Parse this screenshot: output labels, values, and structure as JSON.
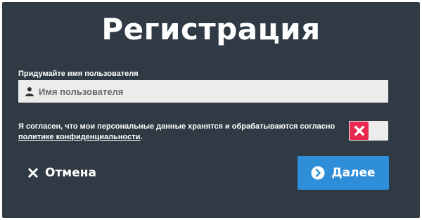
{
  "title": "Регистрация",
  "username": {
    "label": "Придумайте имя пользователя",
    "placeholder": "Имя пользователя",
    "value": ""
  },
  "consent": {
    "text_before": "Я согласен, что мои персональные данные хранятся и обрабатываются согласно ",
    "link_text": "политике конфиденциальности",
    "text_after": ".",
    "checked": false
  },
  "buttons": {
    "cancel_label": "Отмена",
    "next_label": "Далее"
  },
  "icons": {
    "user": "user-icon",
    "toggle_off": "close-icon",
    "cancel": "close-icon",
    "next": "arrow-right-circle-icon"
  },
  "colors": {
    "background": "#2f3a44",
    "accent": "#2e8fd8",
    "toggle_off": "#e8294d",
    "input_bg": "#ececec"
  }
}
